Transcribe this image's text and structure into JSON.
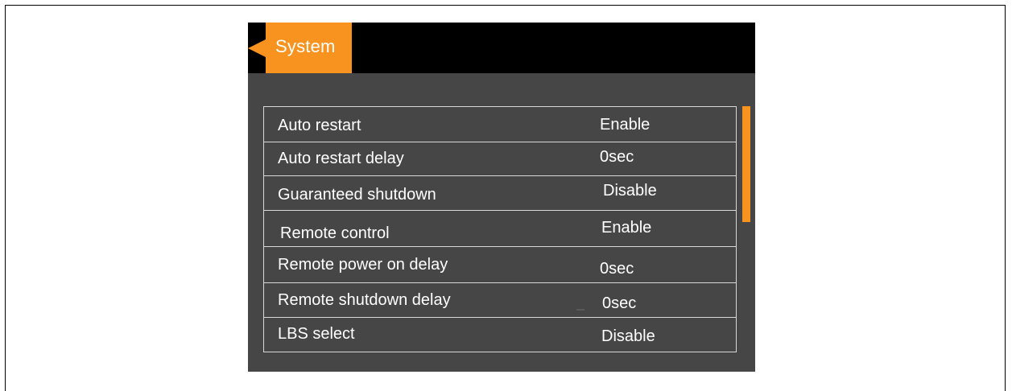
{
  "header": {
    "title": "System"
  },
  "settings": [
    {
      "label": "Auto restart",
      "value": "Enable"
    },
    {
      "label": "Auto restart delay",
      "value": "0sec"
    },
    {
      "label": "Guaranteed shutdown",
      "value": "Disable"
    },
    {
      "label": "Remote control",
      "value": "Enable"
    },
    {
      "label": "Remote power on delay",
      "value": "0sec"
    },
    {
      "label": "Remote shutdown delay",
      "value": "0sec"
    },
    {
      "label": "LBS select",
      "value": "Disable"
    }
  ],
  "colors": {
    "accent": "#f7931e",
    "panel": "#464646",
    "titlebar": "#000000",
    "text": "#ffffff"
  },
  "icons": {
    "back": "back-arrow-icon"
  }
}
